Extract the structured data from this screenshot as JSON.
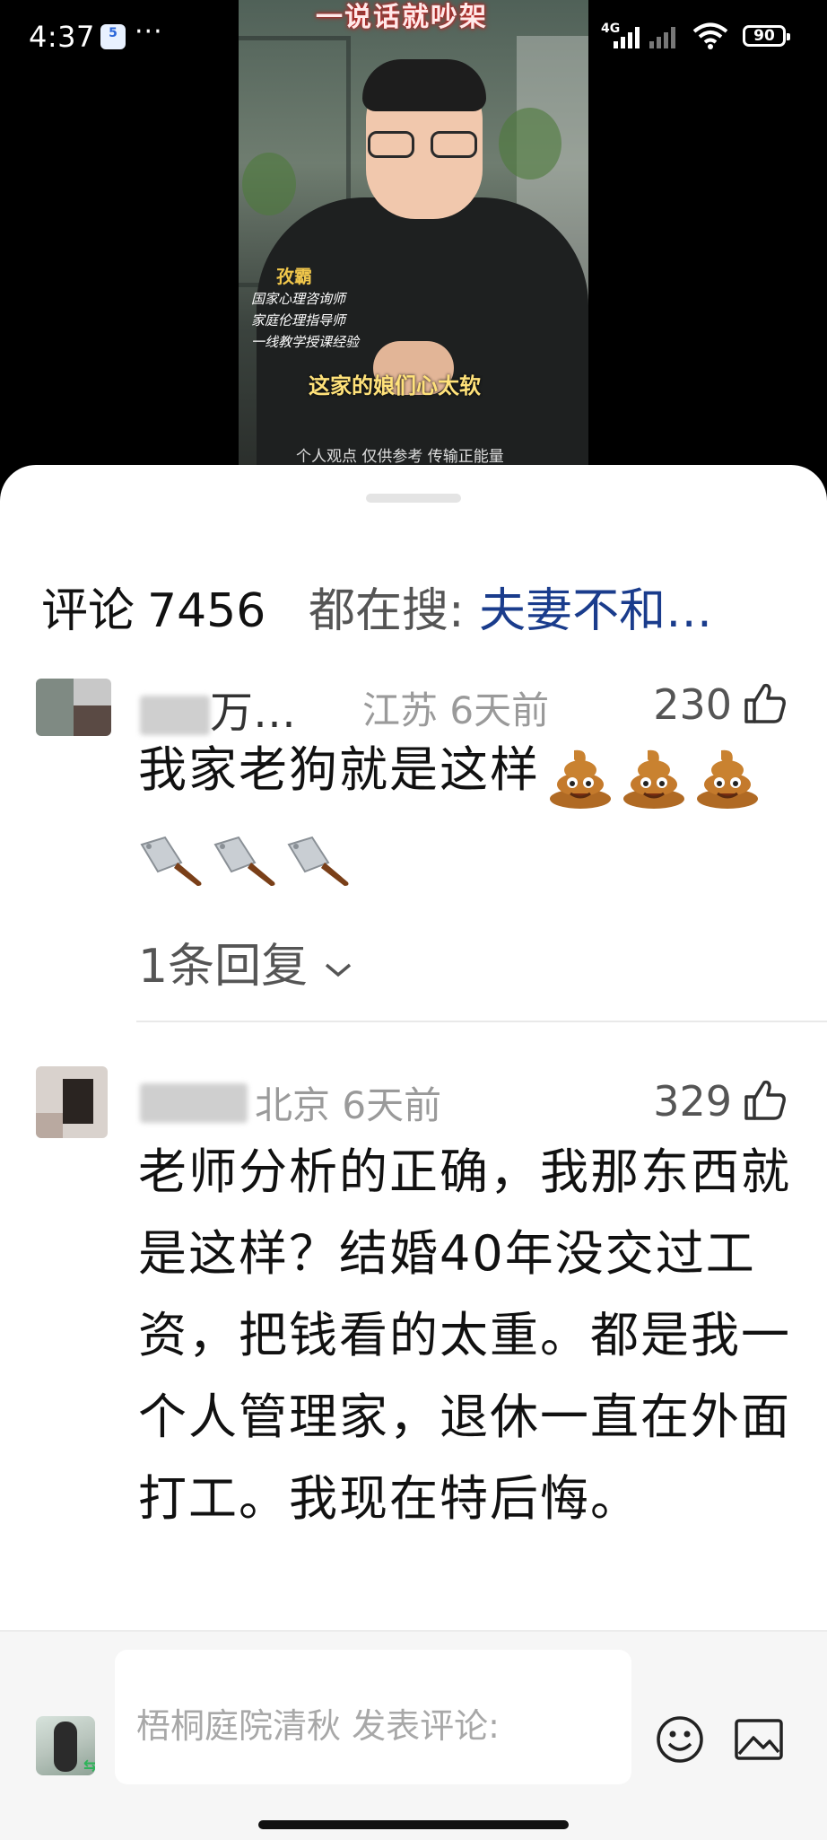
{
  "status_bar": {
    "time": "4:37",
    "app_badge": "5",
    "more": "···",
    "network": "4G",
    "battery": "90",
    "icons": [
      "signal-icon",
      "wifi-icon",
      "battery-icon"
    ]
  },
  "video": {
    "overlay_title": "一说话就吵架",
    "speaker_name": "孜霸",
    "credentials": [
      "国家心理咨询师",
      "家庭伦理指导师",
      "一线教学授课经验"
    ],
    "caption": "这家的娘们心太软",
    "disclaimer": "个人观点 仅供参考 传输正能量"
  },
  "comments_header": {
    "label": "评论",
    "count": "7456",
    "search_prefix": "都在搜:",
    "search_term": "夫妻不和…"
  },
  "comments": [
    {
      "username_visible": "万…",
      "location": "江苏",
      "time": "6天前",
      "likes": "230",
      "text": "我家老狗就是这样",
      "emojis": [
        "pile-of-poo",
        "pile-of-poo",
        "pile-of-poo",
        "cleaver",
        "cleaver",
        "cleaver"
      ],
      "reply_label": "1条回复"
    },
    {
      "username_visible": "",
      "location": "北京",
      "time": "6天前",
      "likes": "329",
      "text": "老师分析的正确，我那东西就是这样？结婚40年没交过工资，把钱看的太重。都是我一个人管理家，退休一直在外面打工。我现在特后悔。"
    }
  ],
  "input_bar": {
    "placeholder": "梧桐庭院清秋 发表评论:",
    "emoji_button": "smiley-icon",
    "image_button": "image-icon"
  },
  "colors": {
    "search_term": "#1a3c8c",
    "meta_gray": "#9a9a9a",
    "sheet_bg": "#ffffff",
    "input_bar_bg": "#f6f6f6"
  }
}
